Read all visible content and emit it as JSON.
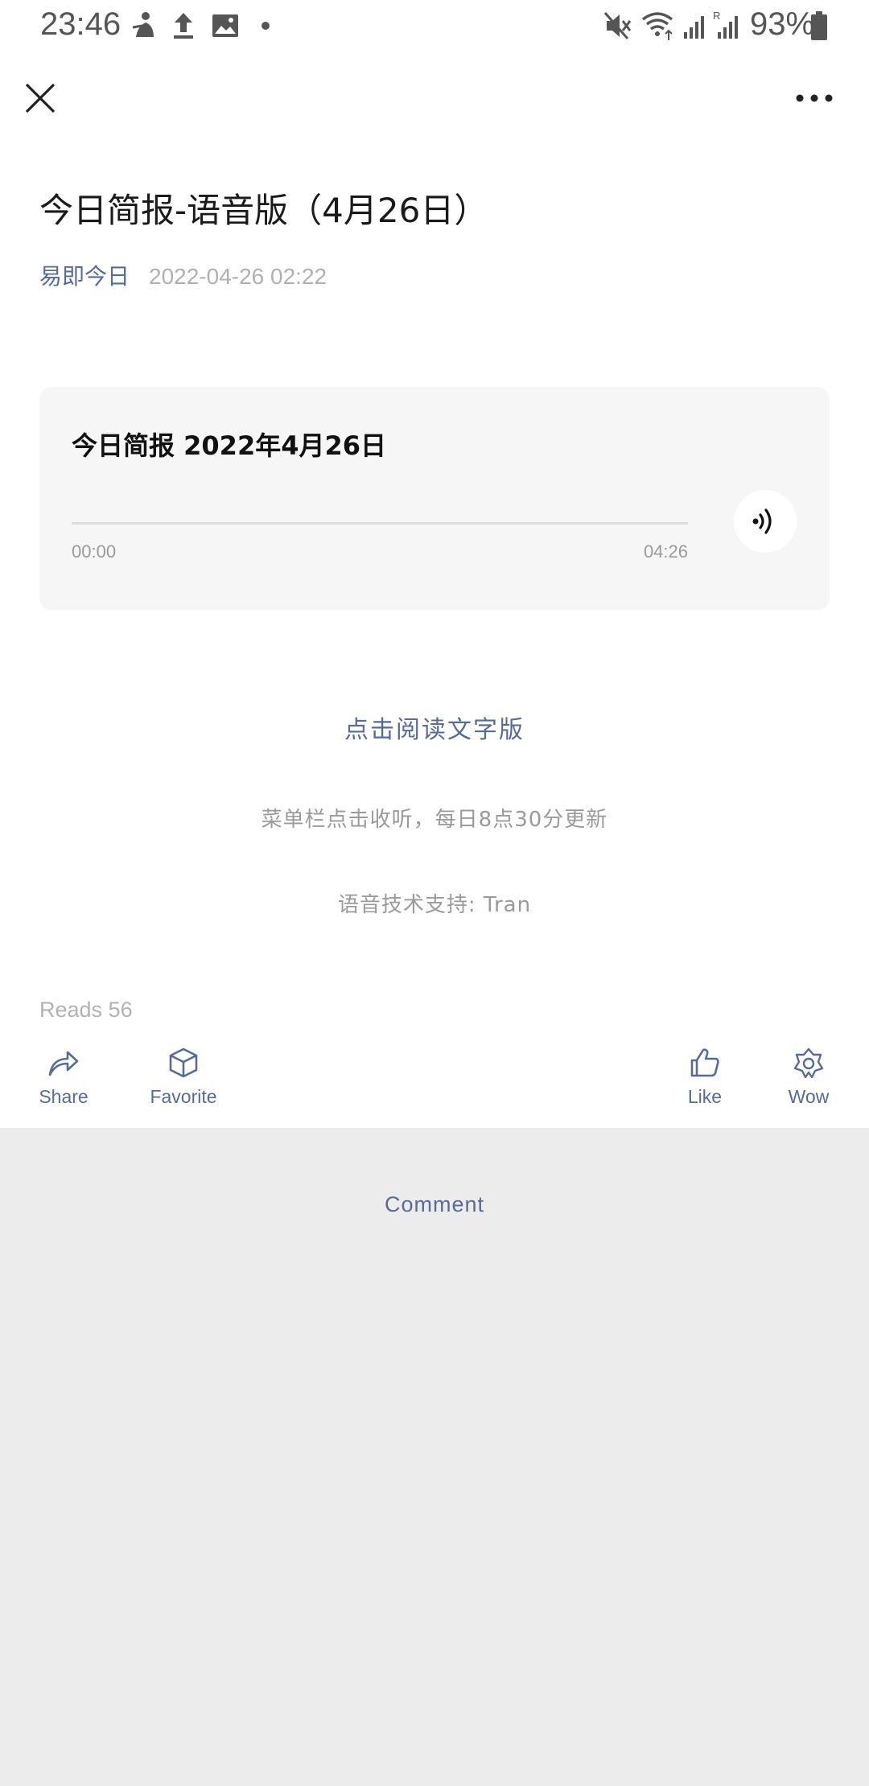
{
  "status_bar": {
    "time": "23:46",
    "battery": "93%",
    "icons": [
      "figure-icon",
      "upload-icon",
      "image-icon",
      "dot-icon",
      "mute-icon",
      "wifi-icon",
      "signal-icon",
      "signal-roaming-icon",
      "battery-icon"
    ]
  },
  "nav": {
    "close_icon": "close-icon",
    "more_icon": "more-icon"
  },
  "article": {
    "title": "今日简报-语音版（4月26日）",
    "author": "易即今日",
    "date": "2022-04-26 02:22"
  },
  "audio": {
    "title": "今日简报 2022年4月26日",
    "current_time": "00:00",
    "total_time": "04:26",
    "progress": 0,
    "play_icon": "audio-play-icon"
  },
  "body": {
    "read_text_link": "点击阅读文字版",
    "update_note": "菜单栏点击收听，每日8点30分更新",
    "tech_support": "语音技术支持: Tran"
  },
  "reads": "Reads 56",
  "actions": {
    "share": "Share",
    "favorite": "Favorite",
    "like": "Like",
    "wow": "Wow"
  },
  "comment": {
    "label": "Comment"
  },
  "colors": {
    "link": "#576b95",
    "muted": "#9a9a9a",
    "card_bg": "#f6f6f6",
    "comment_bg": "#ececed"
  }
}
